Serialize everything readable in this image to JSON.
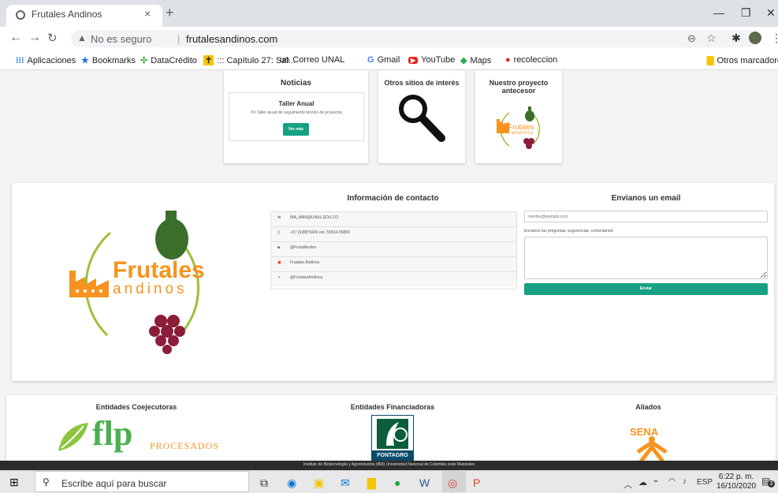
{
  "browser": {
    "tab_title": "Frutales Andinos",
    "tab_close": "×",
    "new_tab": "+",
    "not_secure": "No es seguro",
    "url": "frutalesandinos.com",
    "bookmarks": [
      "Aplicaciones",
      "Bookmarks",
      "DataCrédito",
      "::: Capítulo 27: Sal...",
      "Correo UNAL",
      "Gmail",
      "YouTube",
      "Maps",
      "recoleccion"
    ],
    "bookmark_unal_prefix": "un",
    "bookmark_gmail_prefix": "G",
    "other_bookmarks": "Otros marcadores"
  },
  "top_cards": {
    "noticias": {
      "title": "Noticias",
      "news_title": "Taller Anual",
      "news_text": "XV Taller anual de seguimiento técnico de proyectos",
      "button": "Ver más"
    },
    "otros": {
      "title": "Otros sitios de interés"
    },
    "proyecto": {
      "title": "Nuestro proyecto antecesor"
    }
  },
  "logo": {
    "word1": "Frutales",
    "word2": "andinos"
  },
  "contact": {
    "title": "Información de contacto",
    "items": [
      "IBA_MAN@UNAL.EDU.CO",
      "+57 (6)8879400 ext. 55834-55880",
      "@FrutalAndino",
      "Frutales Andinos",
      "@FrutalesAndinos"
    ]
  },
  "email": {
    "title": "Envianos un email",
    "placeholder": "nombre@ejemplo.com",
    "label": "Envianos tus preguntas, sugerencias, comentarios!",
    "button": "Enviar"
  },
  "entities": {
    "coejecutoras": "Entidades Coejecutoras",
    "financiadoras": "Entidades Financiadoras",
    "aliados": "Aliados",
    "flp": "flp",
    "flp_sub": "PROCESADOS",
    "fontagro": "FONTAGRO",
    "sena": "SENA"
  },
  "footer": {
    "text": "Instituto de Biotecnología y Agroindustria (IBA) Universidad Nacional de Colombia sede Manizales"
  },
  "taskbar": {
    "search": "Escribe aquí para buscar",
    "lang": "ESP",
    "time": "6:22 p. m.",
    "date": "16/10/2020",
    "notif": "3"
  },
  "colors": {
    "accent": "#17a084",
    "orange": "#f7931e",
    "green": "#3c6e2b",
    "wine": "#8c1d3a"
  }
}
